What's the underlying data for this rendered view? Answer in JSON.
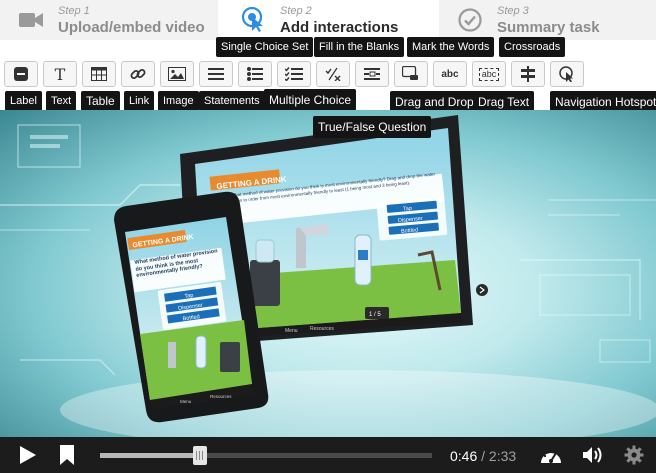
{
  "steps": [
    {
      "number": "Step 1",
      "name": "Upload/embed video",
      "icon": "video-camera-icon"
    },
    {
      "number": "Step 2",
      "name": "Add interactions",
      "icon": "tap-icon",
      "active": true
    },
    {
      "number": "Step 3",
      "name": "Summary task",
      "icon": "check-circle-icon"
    }
  ],
  "toolbar": {
    "tooltips": {
      "label": "Label",
      "text": "Text",
      "table": "Table",
      "link": "Link",
      "image": "Image",
      "statements": "Statements",
      "single_choice_set": "Single Choice Set",
      "multiple_choice": "Multiple Choice",
      "true_false": "True/False Question",
      "fill_blanks": "Fill in the Blanks",
      "drag_drop": "Drag and Drop",
      "mark_words": "Mark the Words",
      "drag_text": "Drag Text",
      "crossroads": "Crossroads",
      "navigation_hotspot": "Navigation Hotspot"
    },
    "text_glyph": "T",
    "drag_text_glyph": "abc",
    "drag_drop_glyph": "abc"
  },
  "video": {
    "tablet_title": "GETTING A DRINK",
    "tablet_question": "What method of water provision do you think is most environmentally friendly? Drag and drop the water types in order from most environmentally friendly to least (1 being most and 3 being least).",
    "phone_title": "GETTING A DRINK",
    "phone_question": "What method of water provision do you think is the most environmentally friendly?",
    "options": [
      "Tap",
      "Dispenser",
      "Bottled"
    ],
    "page_indicator": "1 / 5",
    "menu_label": "Menu",
    "resources_label": "Resources"
  },
  "player": {
    "current_time": "0:46",
    "separator": "/",
    "duration": "2:33",
    "progress": 0.3,
    "colors": {
      "bar_bg": "#1c1c1c",
      "accent": "#2e8de0"
    }
  }
}
